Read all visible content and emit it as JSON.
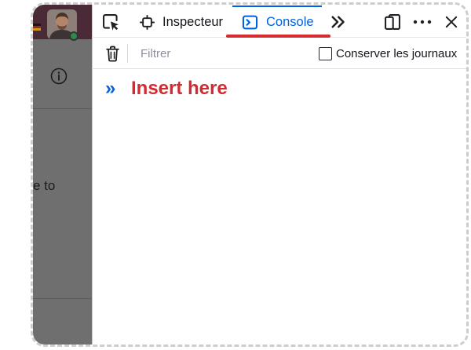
{
  "colors": {
    "accent": "#0061e0",
    "annotation": "#d42a30",
    "overlay": "#6f6f6f",
    "header": "#4b2a37"
  },
  "background_page": {
    "flag_icon": "language-flag-icon",
    "avatar": "user-avatar",
    "info_icon": "info-icon",
    "partial_text": "e to"
  },
  "devtools": {
    "toolbar": {
      "pick_icon": "pick-element-icon",
      "tabs": [
        {
          "label": "Inspecteur",
          "icon": "inspector-icon",
          "selected": false
        },
        {
          "label": "Console",
          "icon": "console-icon",
          "selected": true
        }
      ],
      "overflow_icon": "chevrons-right-icon",
      "dock_icon": "dock-side-icon",
      "more_icon": "more-options-icon",
      "close_icon": "close-icon"
    },
    "filter_bar": {
      "clear_icon": "trash-icon",
      "filter_placeholder": "Filtrer",
      "persist_logs_label": "Conserver les journaux",
      "persist_logs_checked": false
    },
    "console": {
      "prompt": "»",
      "input_annotation": "Insert here"
    }
  }
}
